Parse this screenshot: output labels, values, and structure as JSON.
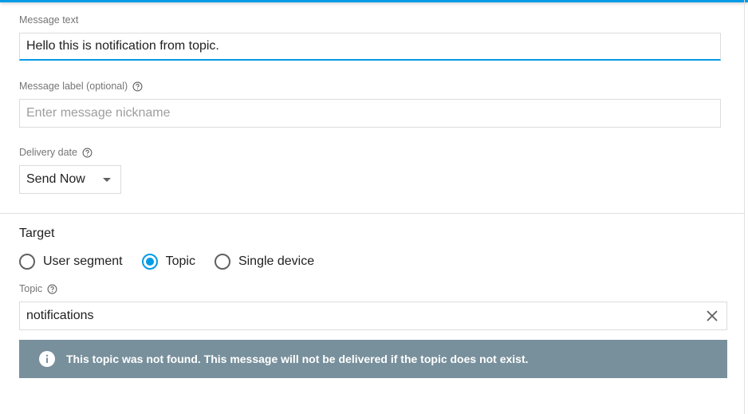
{
  "colors": {
    "accent": "#039be5",
    "banner": "#78909c"
  },
  "message_text": {
    "label": "Message text",
    "value": "Hello this is notification from topic."
  },
  "message_label": {
    "label": "Message label (optional)",
    "placeholder": "Enter message nickname",
    "icon": "help-circle-icon"
  },
  "delivery_date": {
    "label": "Delivery date",
    "selected": "Send Now",
    "icon": "help-circle-icon"
  },
  "target": {
    "title": "Target",
    "options": [
      {
        "label": "User segment",
        "selected": false
      },
      {
        "label": "Topic",
        "selected": true
      },
      {
        "label": "Single device",
        "selected": false
      }
    ]
  },
  "topic": {
    "label": "Topic",
    "value": "notifications",
    "clear_icon": "close-icon"
  },
  "warning": {
    "icon": "info-icon",
    "text": "This topic was not found. This message will not be delivered if the topic does not exist."
  }
}
